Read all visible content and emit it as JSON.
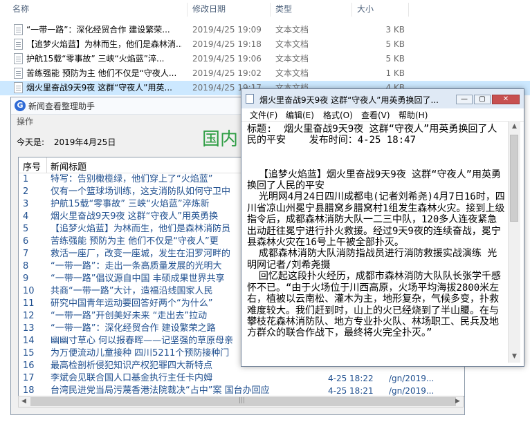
{
  "explorer": {
    "columns": {
      "name": "名称",
      "modified": "修改日期",
      "type": "类型",
      "size": "大小"
    },
    "files": [
      {
        "name": "“一带一路”：深化经贸合作 建设繁荣...",
        "date": "2019/4/25 19:09",
        "type": "文本文档",
        "size": "3 KB"
      },
      {
        "name": "【追梦火焰蓝】为林而生，他们是森林消...",
        "date": "2019/4/25 19:18",
        "type": "文本文档",
        "size": "5 KB"
      },
      {
        "name": "护航15载“零事故” 三峡“火焰蓝”淬...",
        "date": "2019/4/25 19:06",
        "type": "文本文档",
        "size": "5 KB"
      },
      {
        "name": "苦练强能 预防为主 他们不仅是“守夜人...",
        "date": "2019/4/25 19:02",
        "type": "文本文档",
        "size": "1 KB"
      },
      {
        "name": "烟火里奋战9天9夜 这群“守夜人”用英...",
        "date": "2019/4/25 19:17",
        "type": "文本文档",
        "size": "4 KB"
      }
    ]
  },
  "helper": {
    "title": "新闻查看整理助手",
    "menu": "操作",
    "today_label": "今天是:",
    "today_value": "2019年4月25日",
    "big_title": "国内",
    "col_no": "序号",
    "col_title": "新闻标题",
    "rows": [
      {
        "no": "1",
        "title": "特写：告别橄榄绿，他们穿上了“火焰蓝”",
        "date": "",
        "url": ""
      },
      {
        "no": "2",
        "title": "仅有一个篮球场训练，这支消防队如何守卫中",
        "date": "",
        "url": ""
      },
      {
        "no": "3",
        "title": "护航15载“零事故” 三峡“火焰蓝”淬炼新",
        "date": "",
        "url": ""
      },
      {
        "no": "4",
        "title": "烟火里奋战9天9夜 这群“守夜人”用英勇换",
        "date": "",
        "url": ""
      },
      {
        "no": "5",
        "title": "【追梦火焰蓝】为林而生，他们是森林消防员",
        "date": "",
        "url": ""
      },
      {
        "no": "6",
        "title": "苦练强能 预防为主 他们不仅是“守夜人”更",
        "date": "",
        "url": ""
      },
      {
        "no": "7",
        "title": "救活一座厂，改变一座城，发生在汨罗河畔的",
        "date": "",
        "url": ""
      },
      {
        "no": "8",
        "title": "“一带一路”：走出一条高质量发展的光明大",
        "date": "",
        "url": ""
      },
      {
        "no": "9",
        "title": "“一带一路”倡议源自中国 丰硕成果世界共享",
        "date": "",
        "url": ""
      },
      {
        "no": "10",
        "title": "共商“一带一路”大计，造福沿线国家人民",
        "date": "",
        "url": ""
      },
      {
        "no": "11",
        "title": "研究中国青年运动要回答好两个“为什么”",
        "date": "",
        "url": ""
      },
      {
        "no": "12",
        "title": "“一带一路”开创美好未来 “走出去”拉动",
        "date": "",
        "url": ""
      },
      {
        "no": "13",
        "title": "“一带一路”：深化经贸合作 建设繁荣之路",
        "date": "",
        "url": ""
      },
      {
        "no": "14",
        "title": "幽幽寸草心 何以报春晖——记坚强的草原母亲",
        "date": "",
        "url": ""
      },
      {
        "no": "15",
        "title": "为万便流动儿童接种 四川5211个预防接种门",
        "date": "",
        "url": ""
      },
      {
        "no": "16",
        "title": "最高检剖析侵犯知识产权犯罪四大新特点",
        "date": "",
        "url": ""
      },
      {
        "no": "17",
        "title": "李斌会见联合国人口基金执行主任卡内姆",
        "date": "4-25 18:22",
        "url": "/gn/2019..."
      },
      {
        "no": "18",
        "title": "台湾民进党当局污蔑香港法院裁决“占中”案 国台办回应",
        "date": "4-25 18:21",
        "url": "/gn/2019..."
      }
    ]
  },
  "notepad": {
    "title": "烟火里奋战9天9夜 这群“守夜人”用英勇换回了...",
    "win_min": "—",
    "win_max": "▢",
    "win_close": "✕",
    "menu": {
      "file": "文件(F)",
      "edit": "编辑(E)",
      "format": "格式(O)",
      "view": "查看(V)",
      "help": "帮助(H)"
    },
    "body": "标题:  烟火里奋战9天9夜 这群“守夜人”用英勇换回了人民的平安    发布时间：4-25 18:47\n\n\n  【追梦火焰蓝】烟火里奋战9天9夜 这群“守夜人”用英勇换回了人民的平安\n  光明网4月24日四川成都电(记者刘希尧)4月7日16时，四川省凉山州冕宁县腊窝乡腊窝村1组发生森林火灾。接到上级指令后，成都森林消防大队一二三中队，120多人连夜紧急出动赶往冕宁进行扑火救援。经过9天9夜的连续奋战，冕宁县森林火灾在16号上午被全部扑灭。\n  成都森林消防大队消防指战员进行消防救援实战演练 光明网记者/刘希尧摄\n  回忆起这段扑火经历，成都市森林消防大队队长张学千感怀不已。“由于火场位于川西高原，火场平均海拔2800米左右，植被以云南松、灌木为主，地形复杂，气候多变，扑救难度较大。我们赶到时，山上的火已经烧到了半山腰。在与攀枝花森林消防队、地方专业扑火队、林场职工、民兵及地方群众的联合作战下，最终将火完全扑灭。”"
  },
  "colors": {
    "accent_green": "#2f9e45",
    "link_blue": "#1f4f8f",
    "selection": "#cce8ff",
    "close_red": "#c75050"
  }
}
